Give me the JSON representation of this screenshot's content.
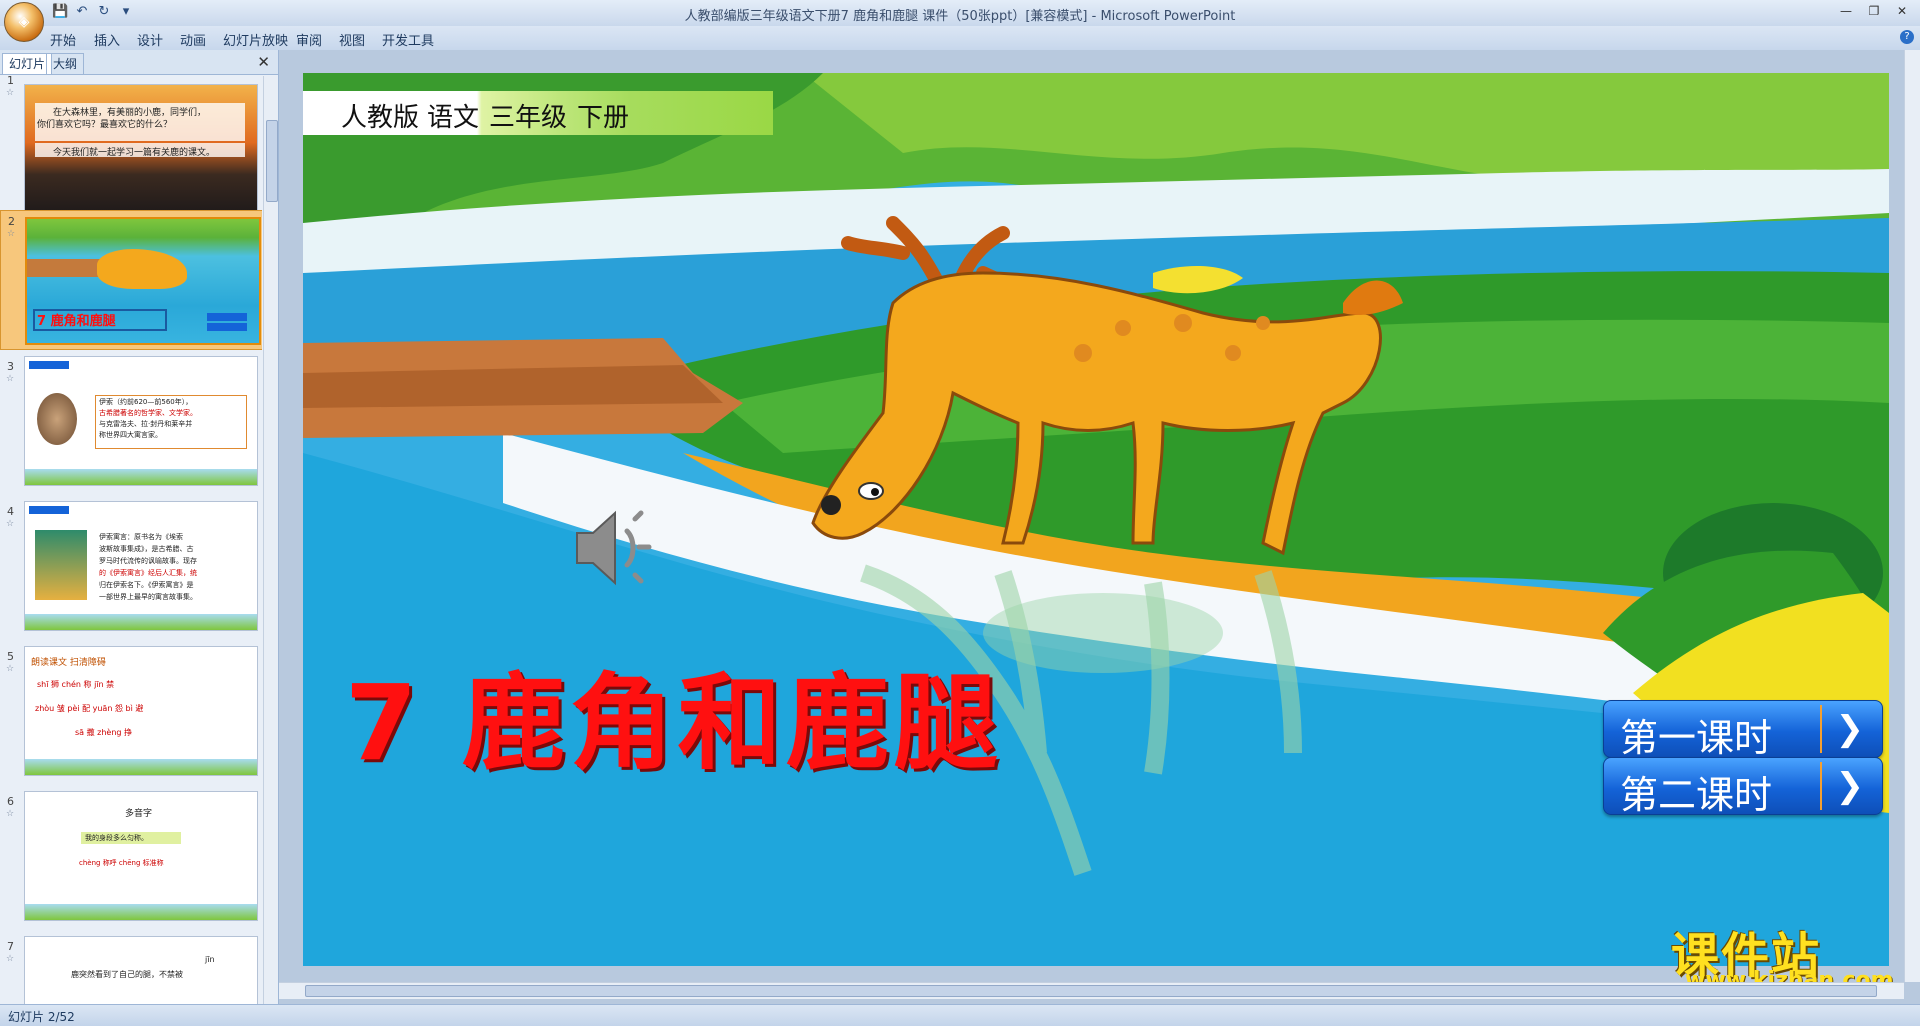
{
  "window": {
    "title": "人教部编版三年级语文下册7 鹿角和鹿腿 课件（50张ppt）[兼容模式] - Microsoft PowerPoint",
    "controls": [
      "—",
      "❐",
      "✕"
    ]
  },
  "qat": {
    "save": "💾",
    "undo": "↶",
    "redo": "↻",
    "more": "▾"
  },
  "menu": [
    "开始",
    "插入",
    "设计",
    "动画",
    "幻灯片放映",
    "审阅",
    "视图",
    "开发工具"
  ],
  "panel": {
    "tabs": [
      "幻灯片",
      "大纲"
    ],
    "close": "✕",
    "thumbs": [
      {
        "num": "1",
        "lines": [
          "在大森林里，有美丽的小鹿，同学们，",
          "你们喜欢它吗？最喜欢它的什么？",
          "今天我们就一起学习一篇有关鹿的课文。"
        ]
      },
      {
        "num": "2",
        "lines": [
          "7 鹿角和鹿腿"
        ]
      },
      {
        "num": "3",
        "lines": [
          "伊索（约前620—前560年），",
          "古希腊著名的哲学家、文学家。",
          "与克雷洛夫、拉·封丹和莱辛并",
          "称世界四大寓言家。"
        ]
      },
      {
        "num": "4",
        "lines": [
          "伊索寓言：原书名为《埃索",
          "波斯故事集成》，是古希腊、古",
          "罗马时代流传的讽喻故事。现存",
          "的《伊索寓言》经后人汇集，统",
          "归在伊索名下。《伊索寓言》是",
          "一部世界上最早的寓言故事集。"
        ]
      },
      {
        "num": "5",
        "lines": [
          "朗读课文 扫清障碍",
          "shī 狮  chén 称  jīn 禁",
          "zhòu 皱  pèi 配  yuān 怨  bì 避",
          "sā 撒  zhèng 挣"
        ]
      },
      {
        "num": "6",
        "lines": [
          "多音字",
          "我的身段多么匀称。",
          "chèng 称呼   chēng 标准称"
        ]
      },
      {
        "num": "7",
        "lines": [
          "jīn",
          "鹿突然看到了自己的腿，不禁被"
        ]
      }
    ]
  },
  "slide": {
    "header": [
      "人教版",
      "语文",
      "三年级",
      "下册"
    ],
    "title": "7  鹿角和鹿腿",
    "buttons": [
      "第一课时",
      "第二课时"
    ],
    "arrow": "❯",
    "watermark": {
      "text": "课件站",
      "url": "www.kjzhan.com"
    }
  },
  "status": {
    "slide_label": "幻灯片 2/52"
  }
}
